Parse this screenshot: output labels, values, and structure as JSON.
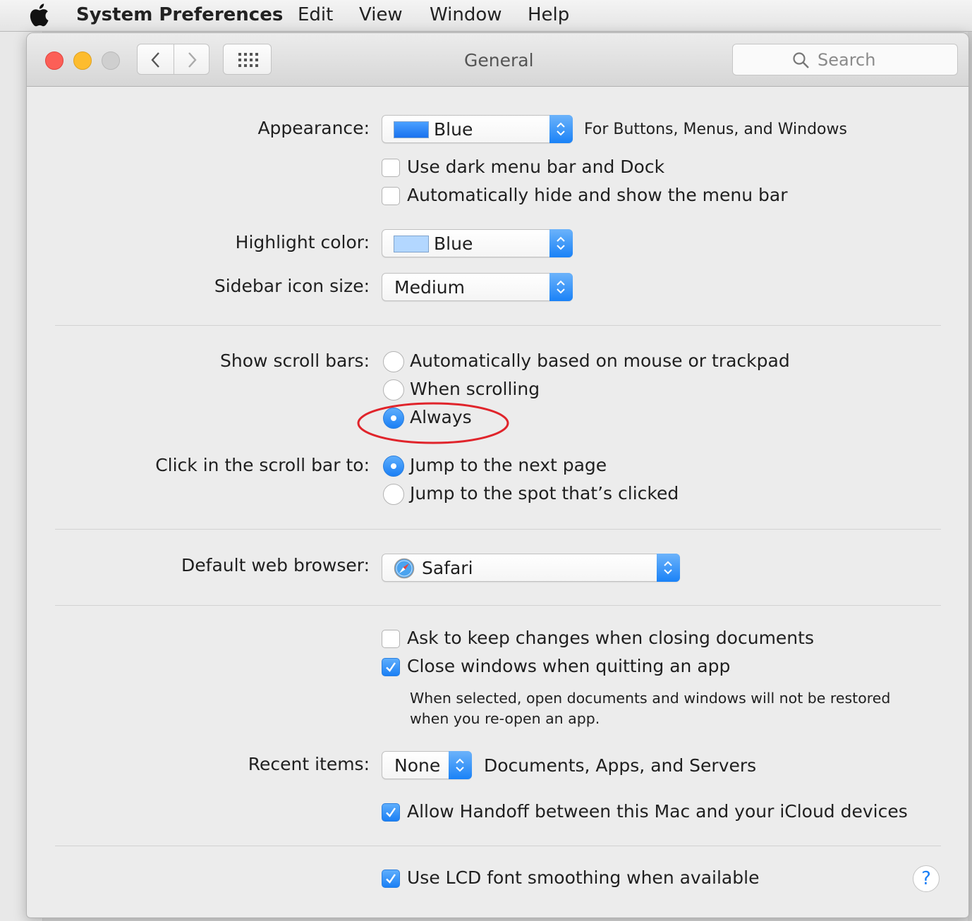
{
  "menubar": {
    "app_name": "System Preferences",
    "items": [
      "Edit",
      "View",
      "Window",
      "Help"
    ]
  },
  "window": {
    "title": "General",
    "search_placeholder": "Search"
  },
  "appearance": {
    "label": "Appearance:",
    "value": "Blue",
    "note": "For Buttons, Menus, and Windows",
    "swatch_color": "#1e7cf3",
    "dark_menu_bar": {
      "label": "Use dark menu bar and Dock",
      "checked": false
    },
    "auto_hide_menu_bar": {
      "label": "Automatically hide and show the menu bar",
      "checked": false
    }
  },
  "highlight_color": {
    "label": "Highlight color:",
    "value": "Blue",
    "swatch_color": "#b3d7ff"
  },
  "sidebar_icon_size": {
    "label": "Sidebar icon size:",
    "value": "Medium"
  },
  "scroll_bars": {
    "label": "Show scroll bars:",
    "options": [
      "Automatically based on mouse or trackpad",
      "When scrolling",
      "Always"
    ],
    "selected": "Always"
  },
  "scroll_click": {
    "label": "Click in the scroll bar to:",
    "options": [
      "Jump to the next page",
      "Jump to the spot that’s clicked"
    ],
    "selected": "Jump to the next page"
  },
  "default_browser": {
    "label": "Default web browser:",
    "value": "Safari"
  },
  "documents": {
    "ask_keep_changes": {
      "label": "Ask to keep changes when closing documents",
      "checked": false
    },
    "close_windows": {
      "label": "Close windows when quitting an app",
      "checked": true
    },
    "close_windows_note_1": "When selected, open documents and windows will not be restored",
    "close_windows_note_2": "when you re-open an app."
  },
  "recent_items": {
    "label": "Recent items:",
    "value": "None",
    "note": "Documents, Apps, and Servers"
  },
  "handoff": {
    "label": "Allow Handoff between this Mac and your iCloud devices",
    "checked": true
  },
  "lcd_smoothing": {
    "label": "Use LCD font smoothing when available",
    "checked": true
  },
  "help_button": "?",
  "colors": {
    "accent": "#1a7ff5",
    "annotation": "#e0242b",
    "close": "#fc5f57",
    "minimize": "#fdbc2e",
    "zoom": "#cfcfcf"
  }
}
